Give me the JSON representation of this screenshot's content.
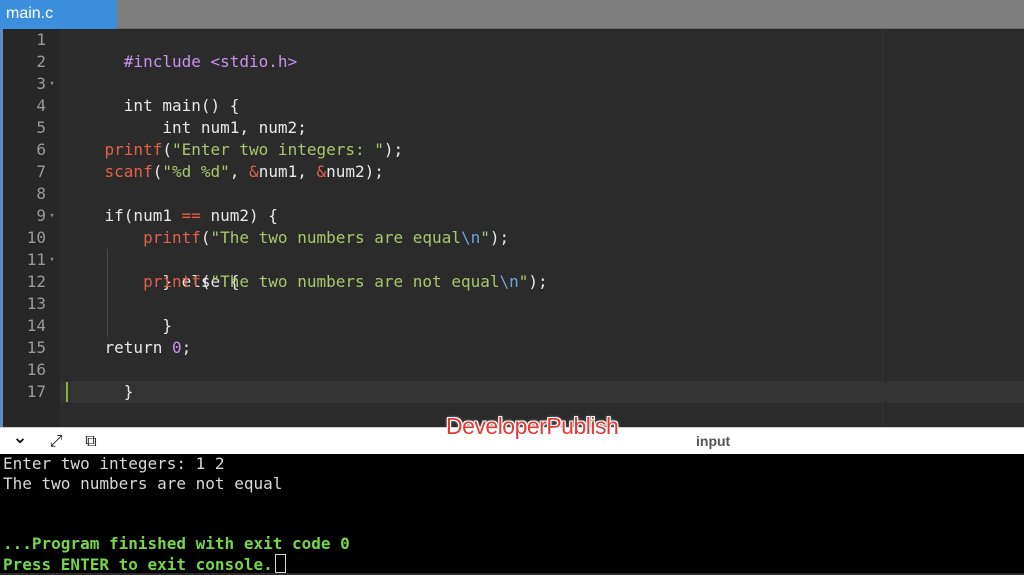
{
  "tab": {
    "label": "main.c"
  },
  "editor": {
    "line_numbers": [
      "1",
      "2",
      "3",
      "4",
      "5",
      "6",
      "7",
      "8",
      "9",
      "10",
      "11",
      "12",
      "13",
      "14",
      "15",
      "16",
      "17"
    ],
    "fold_markers": {
      "3": "▾",
      "9": "▾",
      "11": "▾"
    },
    "code": {
      "l1": {
        "text": "#include <stdio.h>"
      },
      "l3": {
        "text": "int main() {"
      },
      "l4": {
        "text": "    int num1, num2;"
      },
      "l6": {
        "indent": "    ",
        "fn": "printf",
        "open": "(",
        "str": "\"Enter two integers: \"",
        "close": ");"
      },
      "l7": {
        "indent": "    ",
        "fn": "scanf",
        "open": "(",
        "str": "\"%d %d\"",
        "mid1": ", ",
        "amp1": "&",
        "var1": "num1",
        "mid2": ", ",
        "amp2": "&",
        "var2": "num2",
        "close": ");"
      },
      "l9": {
        "indent": "    ",
        "kw": "if",
        "open": "(num1 ",
        "op": "==",
        "rest": " num2) {"
      },
      "l10": {
        "indent": "        ",
        "fn": "printf",
        "open": "(",
        "str": "\"The two numbers are equal",
        "esc": "\\n",
        "strend": "\"",
        "close": ");"
      },
      "l11": {
        "text": "    } else {"
      },
      "l12": {
        "indent": "        ",
        "fn": "printf",
        "open": "(",
        "str": "\"The two numbers are not equal",
        "esc": "\\n",
        "strend": "\"",
        "close": ");"
      },
      "l13": {
        "text": "    }"
      },
      "l15": {
        "indent": "    ",
        "kw": "return ",
        "num": "0",
        "close": ";"
      },
      "l16": {
        "text": "}"
      }
    }
  },
  "io_bar": {
    "icons": [
      "chevron-down-icon",
      "expand-icon",
      "copy-icon"
    ],
    "collapse_glyph": "⌄",
    "expand_glyph": "⤢",
    "copy_glyph": "⧉",
    "label": "input"
  },
  "watermark": "DeveloperPublish",
  "console": {
    "lines": [
      "Enter two integers: 1 2",
      "The two numbers are not equal",
      "",
      "",
      "...Program finished with exit code 0",
      "Press ENTER to exit console."
    ]
  },
  "colors": {
    "tab_active": "#3c8fdd",
    "editor_bg": "#2b2b2b",
    "function": "#e2604a",
    "string": "#a8c66c",
    "escape": "#6fa3d9",
    "preprocessor": "#c792ea",
    "console_green": "#76d64a"
  }
}
